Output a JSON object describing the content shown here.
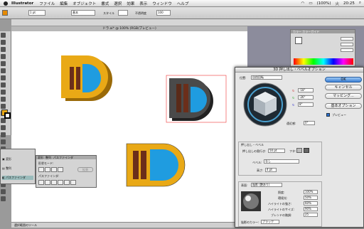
{
  "menubar": {
    "app": "Illustrator",
    "items": [
      "ファイル",
      "編集",
      "オブジェクト",
      "書式",
      "選択",
      "効果",
      "表示",
      "ウィンドウ",
      "ヘルプ"
    ],
    "battery": "(100%)",
    "day": "火",
    "time": "20:25"
  },
  "control": {
    "style_label": "スタイル",
    "opacity_label": "不透明度",
    "opacity": "100",
    "pt": "1 pt",
    "mode": "基本"
  },
  "document": {
    "tab": "ドラ.ai* @ 100% (RGB/プレビュー)"
  },
  "color_panel": {
    "tab1": "カラー",
    "tab2": "カラーガイド"
  },
  "dialog": {
    "title": "3D 押し出し・ベベルオプション",
    "position_label": "位置:",
    "position_value": "自由回転",
    "angle_x": "-18°",
    "angle_y": "-26°",
    "angle_z": "8°",
    "perspective_label": "遠近感:",
    "perspective": "0°",
    "ok": "OK",
    "cancel": "キャンセル",
    "mapping": "マッピング...",
    "basic": "基本オプション",
    "preview": "プレビュー",
    "extrude_section": "押し出し・ベベル",
    "depth_label": "押し出しの奥行き:",
    "depth": "50 pt",
    "cap_label": "フタ:",
    "bevel_label": "ベベル:",
    "bevel_value": "なし",
    "height_label": "高さ:",
    "height": "4 pt",
    "surface_label": "表面:",
    "surface_value": "陰影 (艶あり)",
    "intensity_label": "照度:",
    "intensity": "100%",
    "ambient_label": "環境光:",
    "ambient": "50%",
    "hl_intensity_label": "ハイライトの強さ:",
    "hl_intensity": "60%",
    "hl_size_label": "ハイライトのサイズ:",
    "hl_size": "90%",
    "blend_label": "ブレンドの階調:",
    "blend": "25",
    "shade_label": "陰影のカラー:",
    "shade": "ブラック"
  },
  "left_panel": {
    "items": [
      "変形",
      "整列",
      "パスファインダ"
    ]
  },
  "pathfinder": {
    "tabs": [
      "変形",
      "整列",
      "パスファインダ"
    ],
    "mode_label": "形状モード:",
    "expand": "拡張",
    "pf_label": "パスファインダ:"
  },
  "status": {
    "text": "選択範囲のツール"
  },
  "colors": {
    "logo_yellow": "#e9a916",
    "logo_blue": "#1f9ce0",
    "logo_brown": "#6b2e1a",
    "accent": "#3b7fd4"
  }
}
